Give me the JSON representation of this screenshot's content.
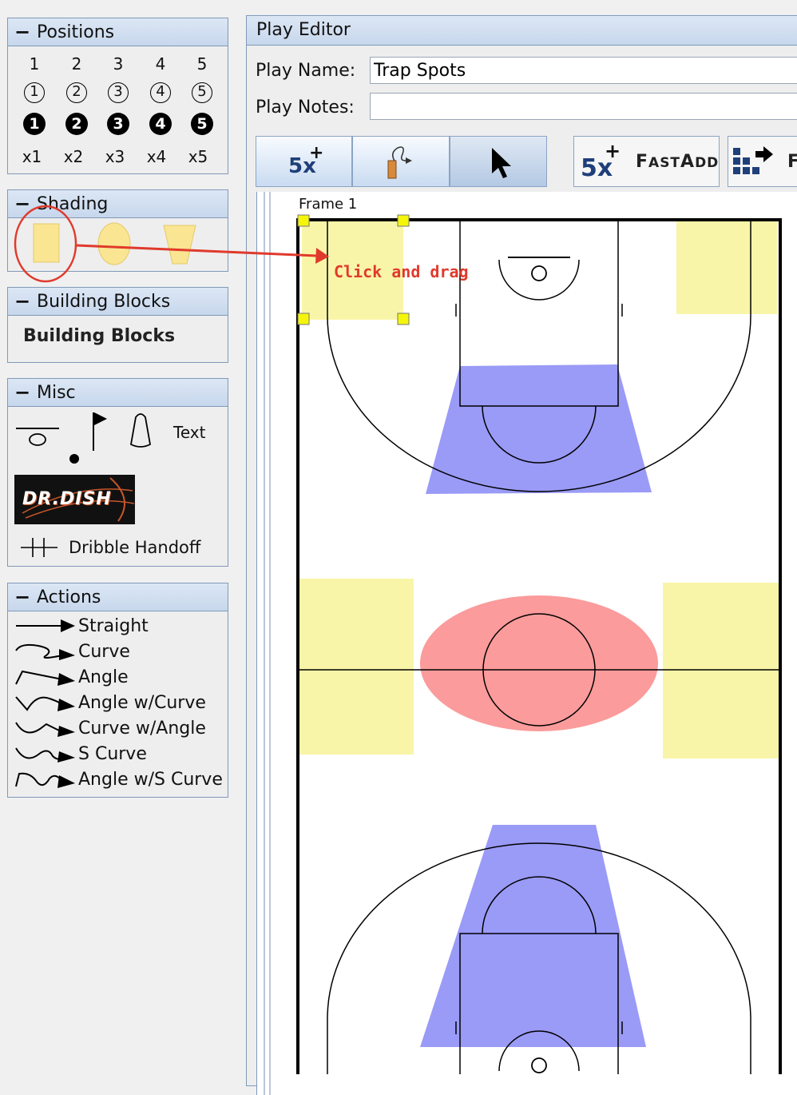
{
  "positions": {
    "title": "Positions",
    "numbers": [
      "1",
      "2",
      "3",
      "4",
      "5"
    ],
    "outlined": [
      "1",
      "2",
      "3",
      "4",
      "5"
    ],
    "filled": [
      "1",
      "2",
      "3",
      "4",
      "5"
    ],
    "x_labels": [
      "x1",
      "x2",
      "x3",
      "x4",
      "x5"
    ]
  },
  "shading": {
    "title": "Shading"
  },
  "building_blocks": {
    "title": "Building Blocks",
    "item": "Building Blocks"
  },
  "misc": {
    "title": "Misc",
    "text_tool": "Text",
    "logo_text": "DR.DISH",
    "dribble_handoff": "Dribble Handoff"
  },
  "actions": {
    "title": "Actions",
    "items": [
      "Straight",
      "Curve",
      "Angle",
      "Angle w/Curve",
      "Curve w/Angle",
      "S Curve",
      "Angle w/S Curve"
    ]
  },
  "editor": {
    "title": "Play Editor",
    "play_name_label": "Play Name:",
    "play_name_value": "Trap Spots",
    "play_notes_label": "Play Notes:",
    "play_notes_value": "",
    "toolbar": {
      "five_x_label": "5x",
      "fast_add_label": "FastAdd",
      "fast_add_first": "F",
      "fast_add_rest": "AST",
      "fast_add_a": "A",
      "fast_add_dd": "DD",
      "partial_label": "F"
    },
    "frame_label": "Frame 1",
    "annotation": "Click and drag"
  },
  "colors": {
    "yellow_zone": "#f9f5a8",
    "blue_zone": "#9a9af7",
    "red_zone": "#fb9b9b",
    "annotation": "#e03a2c"
  }
}
